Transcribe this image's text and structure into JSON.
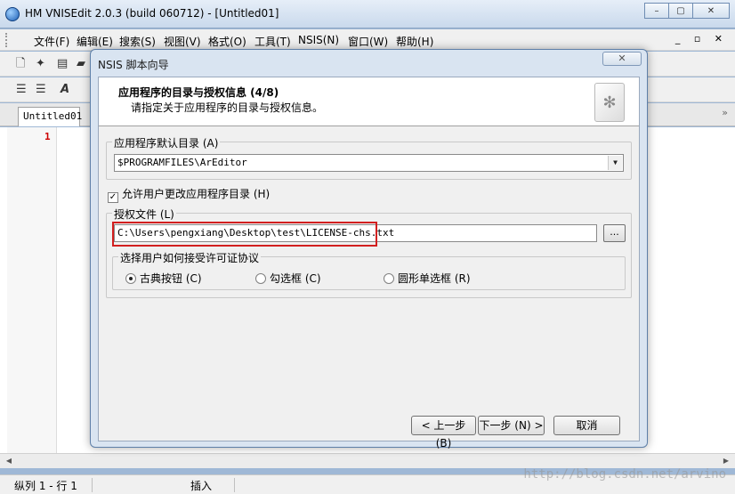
{
  "window": {
    "title": "HM VNISEdit 2.0.3 (build 060712) - [Untitled01]",
    "minimize": "–",
    "restore": "▢",
    "close": "✕"
  },
  "menu": {
    "items": [
      "文件(F)",
      "编辑(E)",
      "搜索(S)",
      "视图(V)",
      "格式(O)",
      "工具(T)",
      "NSIS(N)",
      "窗口(W)",
      "帮助(H)"
    ],
    "mdi_controls": "_ ▫ ✕"
  },
  "tabs": {
    "document": "Untitled01",
    "more": "»"
  },
  "editor": {
    "line_number": "1"
  },
  "status": {
    "position": "纵列 1 - 行 1",
    "mode": "插入"
  },
  "watermark": "http://blog.csdn.net/arvino",
  "dialog": {
    "title": "NSIS 脚本向导",
    "close": "✕",
    "header_title": "应用程序的目录与授权信息 (4/8)",
    "header_subtitle": "请指定关于应用程序的目录与授权信息。",
    "default_dir_label": "应用程序默认目录 (A)",
    "default_dir_value": "$PROGRAMFILES\\ArEditor",
    "allow_change_label": "允许用户更改应用程序目录 (H)",
    "license_group_label": "授权文件 (L)",
    "license_path": "C:\\Users\\pengxiang\\Desktop\\test\\LICENSE-chs.txt",
    "browse_label": "...",
    "accept_group_label": "选择用户如何接受许可证协议",
    "radio_classic": "古典按钮 (C)",
    "radio_checkbox": "勾选框 (C)",
    "radio_radio": "圆形单选框 (R)",
    "back_button": "< 上一步 (B)",
    "next_button": "下一步 (N) >",
    "cancel_button": "取消"
  }
}
